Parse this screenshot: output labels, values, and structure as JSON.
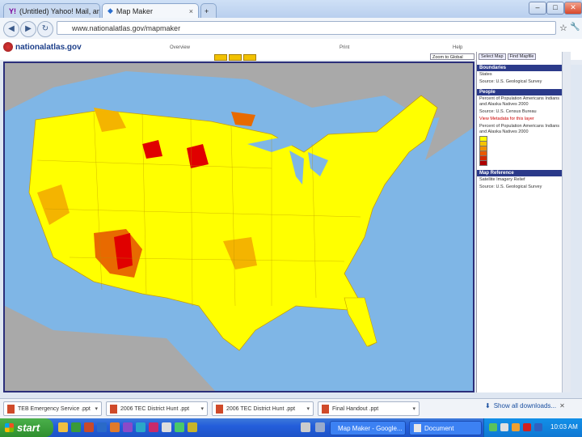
{
  "browser": {
    "tabs": [
      {
        "label": "(Untitled) Yahoo! Mail, ann",
        "close": "×"
      },
      {
        "label": "Map Maker",
        "close": "×"
      }
    ],
    "new_tab": "+",
    "window_controls": [
      "–",
      "□",
      "✕"
    ],
    "address": "www.nationalatlas.gov/mapmaker",
    "star": "☆",
    "wrench": "🔧"
  },
  "site": {
    "logo": "nationalatlas.gov",
    "header_links": [
      "Overview",
      "Print",
      "Help"
    ],
    "map_dropdown": "Zoom to Global",
    "buttons": [
      "Select Map",
      "Find Mapfile"
    ]
  },
  "panel": {
    "sections": [
      {
        "title": "Boundaries",
        "lines": [
          "States",
          "Source: U.S. Geological Survey"
        ]
      },
      {
        "title": "People",
        "lines": [
          "Percent of Population Americans Indians and Alaska Natives 2000",
          "Source: U.S. Census Bureau"
        ]
      },
      {
        "title": "Map Reference",
        "lines": [
          "Satellite Imagery Relief",
          "Source: U.S. Geological Survey"
        ]
      }
    ],
    "red_line": "View Metadata for this layer",
    "extra_line": "Percent of Population Americans Indians and Alaska Natives 2000",
    "legend_colors": [
      "#ffff00",
      "#f6c400",
      "#f09000",
      "#e85a00",
      "#d42a00",
      "#b00000"
    ]
  },
  "downloads": {
    "items": [
      "TEB Emergency Service .ppt",
      "2006 TEC District Hunt .ppt",
      "2006 TEC District Hunt .ppt",
      "Final Handout .ppt"
    ],
    "show_all": "Show all downloads..."
  },
  "taskbar": {
    "start": "start",
    "tasks": [
      "Map Maker - Google...",
      "Document"
    ],
    "clock": "10:03 AM"
  },
  "colors": {
    "ocean": "#7fb6e6",
    "land": "#a9a9a9",
    "county_base": "#ffff00",
    "county_mid": "#f4b400",
    "county_high": "#e86a00",
    "county_max": "#e00000"
  }
}
